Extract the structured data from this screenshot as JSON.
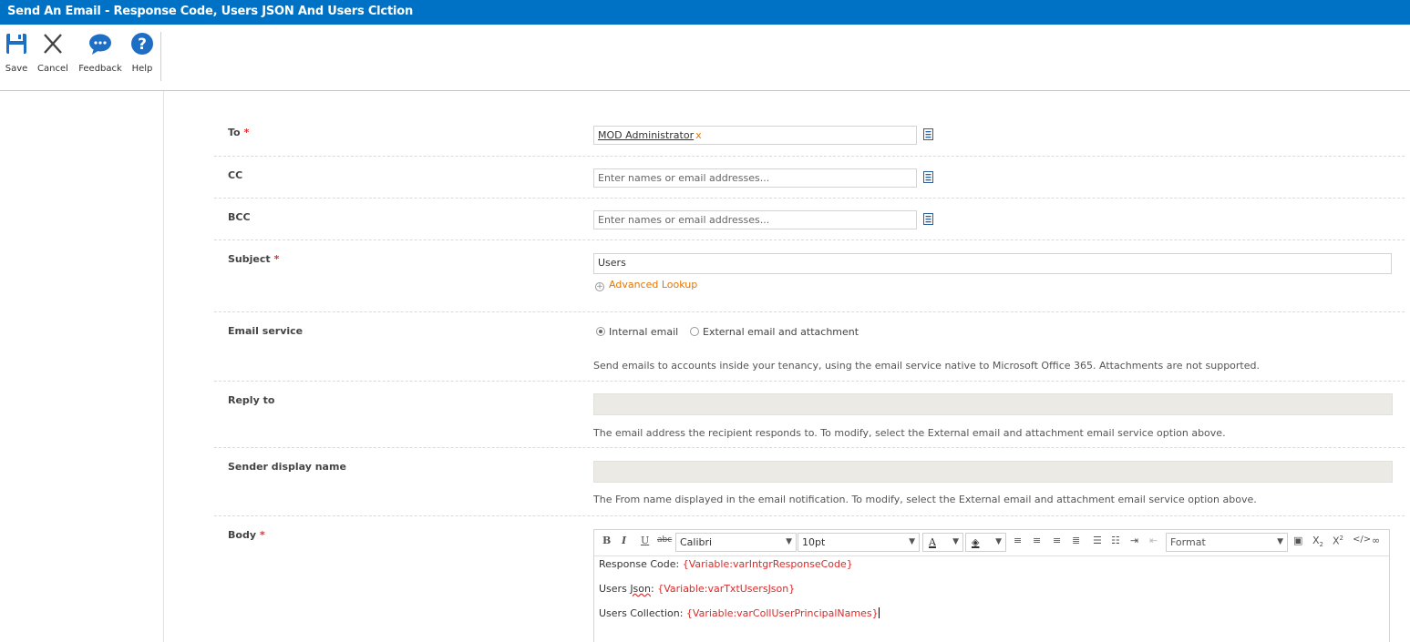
{
  "window": {
    "title": "Send An Email - Response Code, Users JSON And Users Clction"
  },
  "ribbon": {
    "save": "Save",
    "cancel": "Cancel",
    "feedback": "Feedback",
    "help": "Help"
  },
  "form": {
    "to": {
      "label": "To",
      "required": "*",
      "token": "MOD Administrator",
      "remove": "x"
    },
    "cc": {
      "label": "CC",
      "placeholder": "Enter names or email addresses..."
    },
    "bcc": {
      "label": "BCC",
      "placeholder": "Enter names or email addresses..."
    },
    "subject": {
      "label": "Subject",
      "required": "*",
      "value": "Users",
      "advanced_lookup": "Advanced Lookup"
    },
    "email_service": {
      "label": "Email service",
      "options": [
        "Internal email",
        "External email and attachment"
      ],
      "selected": "Internal email",
      "help": "Send emails to accounts inside your tenancy, using the email service native to Microsoft Office 365. Attachments are not supported."
    },
    "reply_to": {
      "label": "Reply to",
      "help": "The email address the recipient responds to. To modify, select the External email and attachment email service option above."
    },
    "sender_display_name": {
      "label": "Sender display name",
      "help": "The From name displayed in the email notification. To modify, select the External email and attachment email service option above."
    },
    "body": {
      "label": "Body",
      "required": "*",
      "font": "Calibri",
      "size": "10pt",
      "format": "Format",
      "lines": [
        {
          "text": "Response Code: ",
          "var": "{Variable:varIntgrResponseCode}"
        },
        {
          "text_a": "Users ",
          "text_squig": "Json",
          "text_b": ": ",
          "var": "{Variable:varTxtUsersJson}"
        },
        {
          "text": "Users Collection: ",
          "var": "{Variable:varCollUserPrincipalNames}"
        }
      ]
    }
  },
  "colors": {
    "titlebar": "#0072c6",
    "accent": "#e87500",
    "required": "#e03030",
    "variable": "#d92b2b"
  }
}
